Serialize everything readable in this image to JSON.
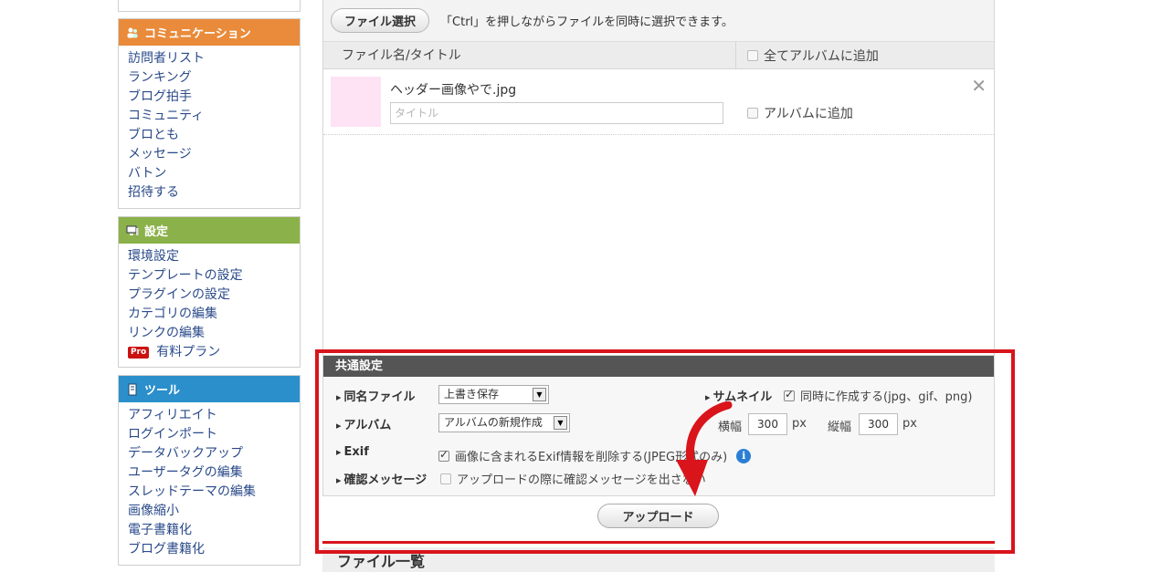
{
  "sidebar": {
    "communication": {
      "title": "コミュニケーション",
      "color": "#e98b3a",
      "items": [
        "訪問者リスト",
        "ランキング",
        "ブログ拍手",
        "コミュニティ",
        "ブロとも",
        "メッセージ",
        "バトン",
        "招待する"
      ]
    },
    "settings": {
      "title": "設定",
      "color": "#8bb14a",
      "items": [
        "環境設定",
        "テンプレートの設定",
        "プラグインの設定",
        "カテゴリの編集",
        "リンクの編集"
      ],
      "pro_badge": "Pro",
      "pro_item": "有料プラン"
    },
    "tools": {
      "title": "ツール",
      "color": "#2b8fcc",
      "items": [
        "アフィリエイト",
        "ログインポート",
        "データバックアップ",
        "ユーザータグの編集",
        "スレッドテーマの編集",
        "画像縮小",
        "電子書籍化",
        "ブログ書籍化"
      ]
    }
  },
  "toolbar": {
    "file_select_label": "ファイル選択",
    "hint": "「Ctrl」を押しながらファイルを同時に選択できます。"
  },
  "table": {
    "col_filename": "ファイル名/タイトル",
    "col_album_all": "全てアルバムに追加"
  },
  "file": {
    "name": "ヘッダー画像やで.jpg",
    "title_placeholder": "タイトル",
    "album_add": "アルバムに追加",
    "close_glyph": "✕"
  },
  "common": {
    "header": "共通設定",
    "same_name_label": "同名ファイル",
    "same_name_value": "上書き保存",
    "album_label": "アルバム",
    "album_value": "アルバムの新規作成",
    "exif_label": "Exif",
    "exif_option": "画像に含まれるExif情報を削除する(JPEG形式のみ)",
    "confirm_label": "確認メッセージ",
    "confirm_option": "アップロードの際に確認メッセージを出さない",
    "thumb_label": "サムネイル",
    "thumb_option": "同時に作成する(jpg、gif、png)",
    "width_label": "横幅",
    "width_value": "300",
    "height_label": "縦幅",
    "height_value": "300",
    "unit": "px",
    "info_glyph": "i"
  },
  "upload_label": "アップロード",
  "filelist_title": "ファイル一覧",
  "highlight_color": "#d9141b"
}
